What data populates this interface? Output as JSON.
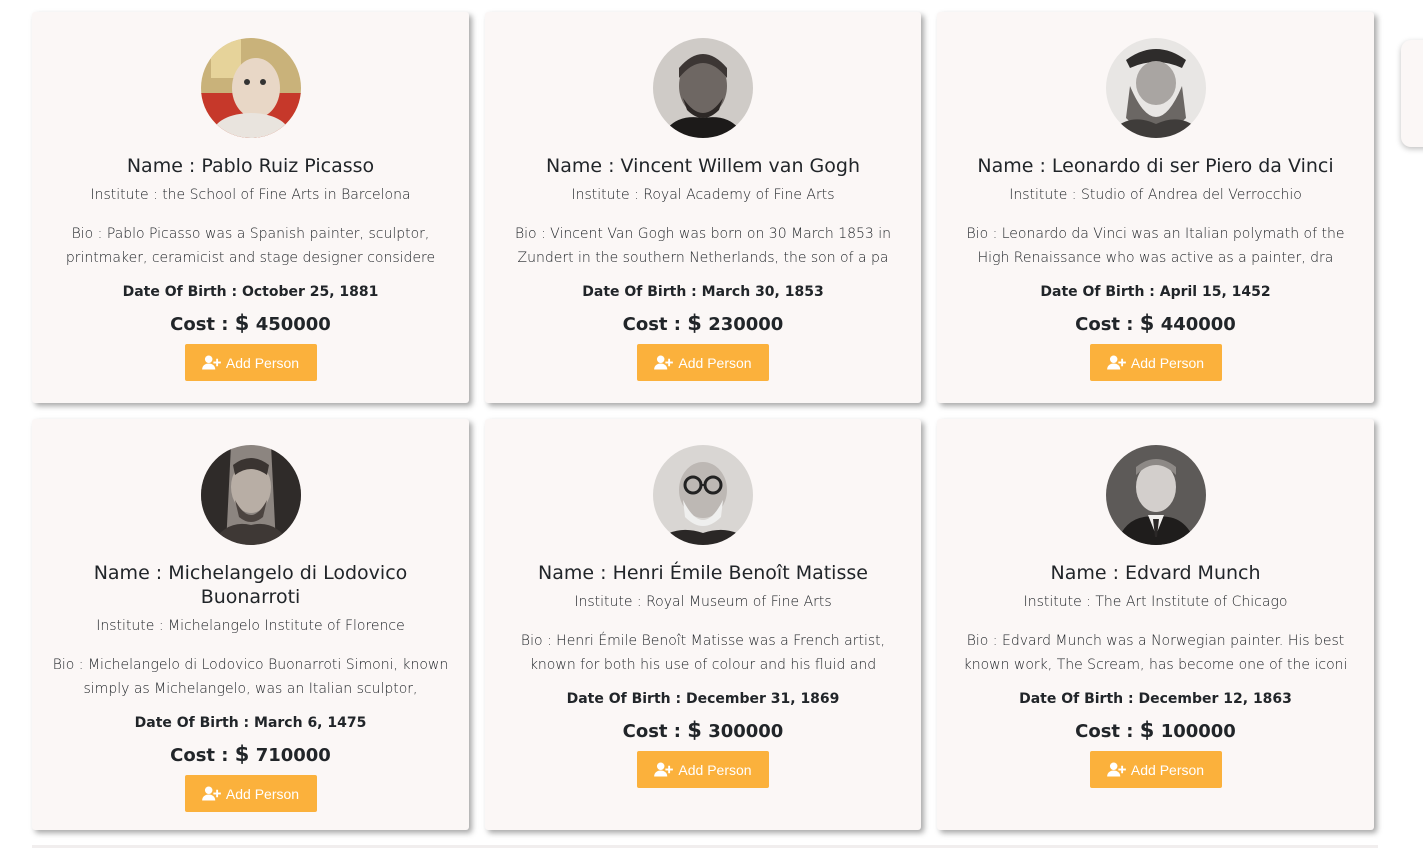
{
  "cards": [
    {
      "name": "Name : Pablo Ruiz Picasso",
      "institute": "Institute : the School of Fine Arts in Barcelona",
      "bio": "Bio : Pablo Picasso was a Spanish painter, sculptor, printmaker, ceramicist and stage designer considere",
      "dob": "Date Of Birth : October 25, 1881",
      "cost_label": "Cost :",
      "cost_symbol": "$",
      "cost_value": "450000",
      "button_label": "Add Person"
    },
    {
      "name": "Name : Vincent Willem van Gogh",
      "institute": "Institute : Royal Academy of Fine Arts",
      "bio": "Bio : Vincent Van Gogh was born on 30 March 1853 in Zundert in the southern Netherlands, the son of a pa",
      "dob": "Date Of Birth : March 30, 1853",
      "cost_label": "Cost :",
      "cost_symbol": "$",
      "cost_value": "230000",
      "button_label": "Add Person"
    },
    {
      "name": "Name : Leonardo di ser Piero da Vinci",
      "institute": "Institute : Studio of Andrea del Verrocchio",
      "bio": "Bio : Leonardo da Vinci was an Italian polymath of the High Renaissance who was active as a painter, dra",
      "dob": "Date Of Birth : April 15, 1452",
      "cost_label": "Cost :",
      "cost_symbol": "$",
      "cost_value": "440000",
      "button_label": "Add Person"
    },
    {
      "name": "Name : Michelangelo di Lodovico Buonarroti",
      "institute": "Institute : Michelangelo Institute of Florence",
      "bio": "Bio : Michelangelo di Lodovico Buonarroti Simoni, known simply as Michelangelo, was an Italian sculptor,",
      "dob": "Date Of Birth : March 6, 1475",
      "cost_label": "Cost :",
      "cost_symbol": "$",
      "cost_value": "710000",
      "button_label": "Add Person"
    },
    {
      "name": "Name : Henri Émile Benoît Matisse",
      "institute": "Institute : Royal Museum of Fine Arts",
      "bio": "Bio : Henri Émile Benoît Matisse was a French artist, known for both his use of colour and his fluid and",
      "dob": "Date Of Birth : December 31, 1869",
      "cost_label": "Cost :",
      "cost_symbol": "$",
      "cost_value": "300000",
      "button_label": "Add Person"
    },
    {
      "name": "Name : Edvard Munch",
      "institute": "Institute : The Art Institute of Chicago",
      "bio": "Bio : Edvard Munch was a Norwegian painter. His best known work, The Scream, has become one of the iconi",
      "dob": "Date Of Birth : December 12, 1863",
      "cost_label": "Cost :",
      "cost_symbol": "$",
      "cost_value": "100000",
      "button_label": "Add Person"
    }
  ],
  "icons": {
    "avatar": "portrait-photo",
    "button": "user-plus-icon"
  },
  "colors": {
    "card_background": "#fbf7f6",
    "button_background": "#fbb13c",
    "button_text": "#ffffff"
  }
}
